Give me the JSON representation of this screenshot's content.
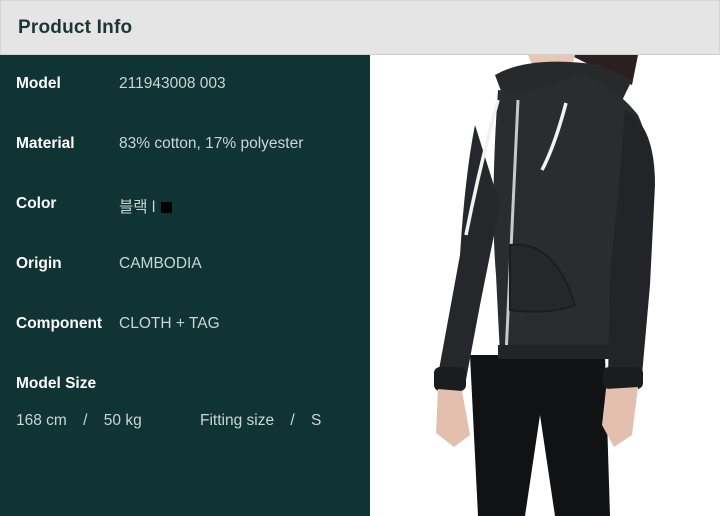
{
  "header": {
    "title": "Product Info"
  },
  "details": [
    {
      "label": "Model",
      "value": "211943008 003"
    },
    {
      "label": "Material",
      "value": "83% cotton, 17% polyester"
    },
    {
      "label": "Color",
      "value": "블랙 l"
    },
    {
      "label": "Origin",
      "value": "CAMBODIA"
    },
    {
      "label": "Component",
      "value": "CLOTH + TAG"
    }
  ],
  "model_size": {
    "label": "Model Size",
    "height": "168 cm",
    "sep1": "/",
    "weight": "50 kg",
    "fitting_label": "Fitting size",
    "sep2": "/",
    "fitting_value": "S"
  },
  "colors": {
    "panel_bg": "#0f3433",
    "header_bg": "#e5e5e5",
    "swatch": "#000000"
  },
  "photo": {
    "subject": "model-wearing-black-zip-hoodie",
    "icon": "product-photo"
  }
}
